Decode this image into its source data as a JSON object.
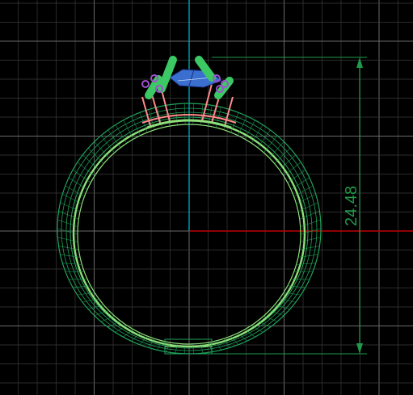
{
  "viewport": {
    "background": "#000000",
    "grid_minor_color": "#3a3a3a",
    "grid_major_color": "#6a6a6a",
    "axis_x_color": "#c00000",
    "axis_y_color": "#00a0b0"
  },
  "model": {
    "shank_color": "#1fa35a",
    "inner_band_color": "#8ee07a",
    "prong_color": "#3cc864",
    "stone_color": "#3a6fd0",
    "gallery_color": "#ff8a8a",
    "bead_color": "#a050d0"
  },
  "dimension": {
    "value": "24.48",
    "color": "#1f9a4a"
  }
}
